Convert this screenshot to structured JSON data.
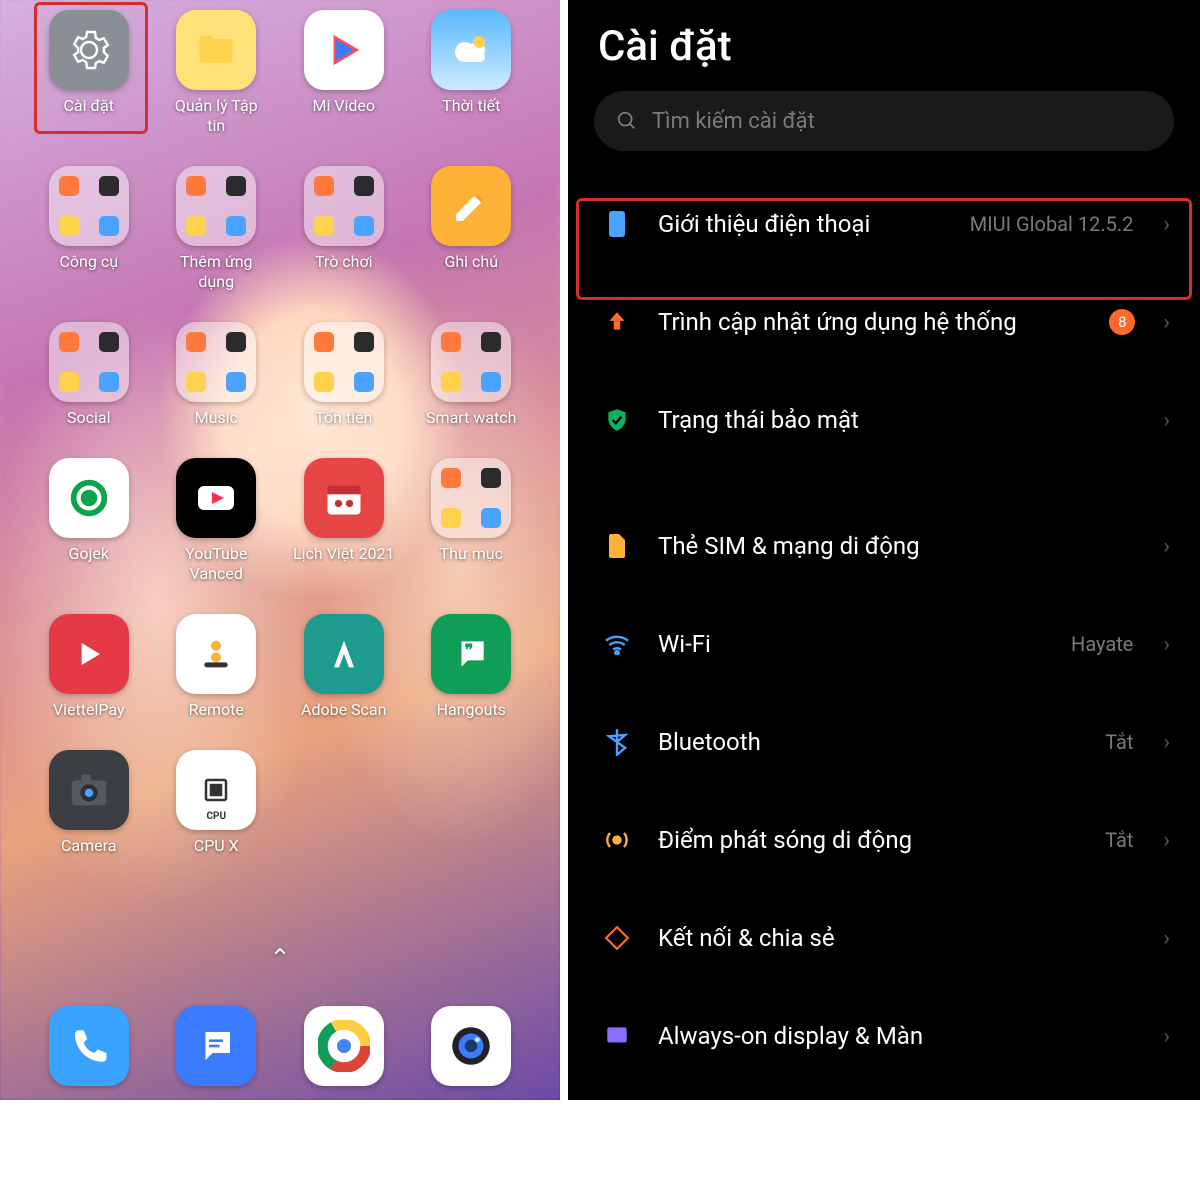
{
  "home": {
    "apps": [
      {
        "label": "Cài đặt",
        "icon": "gear",
        "style": "ic-settings"
      },
      {
        "label": "Quản lý Tập tin",
        "icon": "folder",
        "style": "ic-files"
      },
      {
        "label": "Mi Video",
        "icon": "play-tri",
        "style": "ic-video"
      },
      {
        "label": "Thời tiết",
        "icon": "cloud",
        "style": "ic-weather"
      },
      {
        "label": "Công cụ",
        "icon": "folder-group",
        "style": "folder"
      },
      {
        "label": "Thêm ứng dụng",
        "icon": "folder-group",
        "style": "folder"
      },
      {
        "label": "Trò chơi",
        "icon": "folder-group",
        "style": "folder"
      },
      {
        "label": "Ghi chú",
        "icon": "pencil",
        "style": "ic-note"
      },
      {
        "label": "Social",
        "icon": "folder-group",
        "style": "folder"
      },
      {
        "label": "Music",
        "icon": "folder-group",
        "style": "folder"
      },
      {
        "label": "Tốn tiền",
        "icon": "folder-group",
        "style": "folder"
      },
      {
        "label": "Smart watch",
        "icon": "folder-group",
        "style": "folder"
      },
      {
        "label": "Gojek",
        "icon": "target",
        "style": "ic-gojek"
      },
      {
        "label": "YouTube Vanced",
        "icon": "yt",
        "style": "ic-ytv"
      },
      {
        "label": "Lịch Việt 2021",
        "icon": "calendar",
        "style": "ic-cal"
      },
      {
        "label": "Thư mục",
        "icon": "folder-group",
        "style": "folder"
      },
      {
        "label": "ViettelPay",
        "icon": "vplay",
        "style": "ic-vpay"
      },
      {
        "label": "Remote",
        "icon": "remote",
        "style": "ic-remote"
      },
      {
        "label": "Adobe Scan",
        "icon": "adobe",
        "style": "ic-adobe"
      },
      {
        "label": "Hangouts",
        "icon": "quote",
        "style": "ic-hang"
      },
      {
        "label": "Camera",
        "icon": "camera",
        "style": "ic-cam"
      },
      {
        "label": "CPU X",
        "icon": "cpu",
        "style": "ic-cpu"
      }
    ],
    "dock": [
      {
        "label": "Phone",
        "icon": "phone",
        "style": "ic-phone"
      },
      {
        "label": "Messages",
        "icon": "msg",
        "style": "ic-msg"
      },
      {
        "label": "Chrome",
        "icon": "chrome",
        "style": "ic-chrome"
      },
      {
        "label": "Camera",
        "icon": "lens",
        "style": "ic-lens"
      }
    ],
    "pager_glyph": "⌃"
  },
  "settings": {
    "title": "Cài đặt",
    "search_placeholder": "Tìm kiếm cài đặt",
    "items": [
      {
        "icon": "phone-rect",
        "color": "#4aa3ff",
        "label": "Giới thiệu điện thoại",
        "value": "MIUI Global 12.5.2"
      },
      {
        "icon": "arrow-up",
        "color": "#ff6a2b",
        "label": "Trình cập nhật ứng dụng hệ thống",
        "badge": "8"
      },
      {
        "icon": "shield",
        "color": "#0faf5c",
        "label": "Trạng thái bảo mật"
      },
      {
        "gap": true
      },
      {
        "icon": "sim",
        "color": "#ffb238",
        "label": "Thẻ SIM & mạng di động"
      },
      {
        "icon": "wifi",
        "color": "#4aa3ff",
        "label": "Wi-Fi",
        "value": "Hayate"
      },
      {
        "icon": "bluetooth",
        "color": "#4aa3ff",
        "label": "Bluetooth",
        "value": "Tắt"
      },
      {
        "icon": "hotspot",
        "color": "#ffb238",
        "label": "Điểm phát sóng di động",
        "value": "Tắt"
      },
      {
        "icon": "share",
        "color": "#ff6a2b",
        "label": "Kết nối & chia sẻ"
      },
      {
        "icon": "display",
        "color": "#8a6dff",
        "label": "Always-on display & Màn"
      }
    ]
  }
}
